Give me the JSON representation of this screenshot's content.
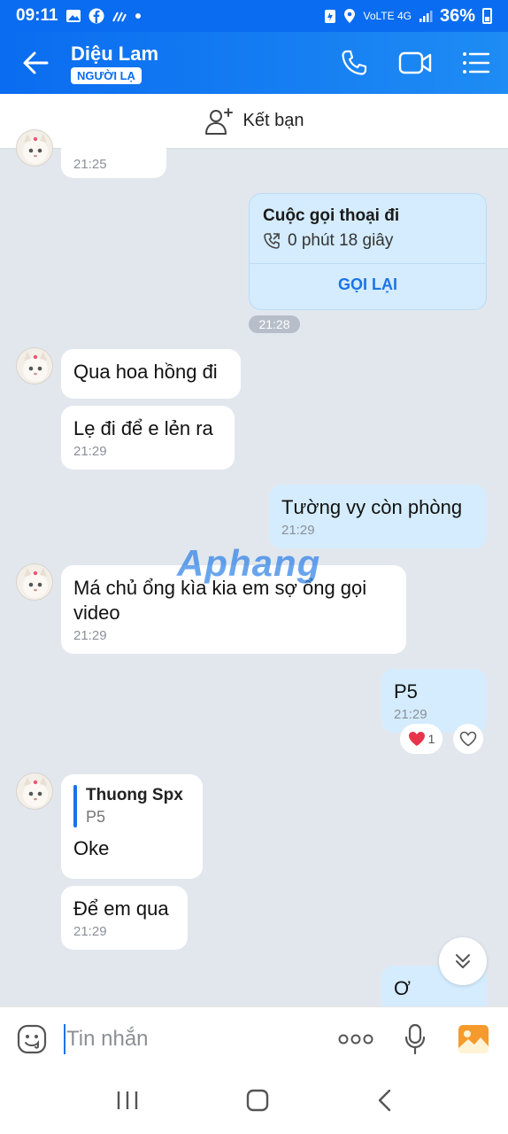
{
  "status_bar": {
    "time": "09:11",
    "network": "VoLTE 4G",
    "battery": "36%"
  },
  "header": {
    "contact_name": "Diệu Lam",
    "badge": "NGƯỜI LẠ",
    "icons": [
      "back-arrow-icon",
      "phone-icon",
      "video-call-icon",
      "menu-icon"
    ]
  },
  "add_friend": {
    "label": "Kết bạn",
    "icon": "add-person-icon"
  },
  "messages": [
    {
      "id": "m0",
      "side": "in",
      "text": "",
      "time": "21:25"
    },
    {
      "id": "call",
      "side": "out",
      "type": "call",
      "title": "Cuộc gọi thoại đi",
      "duration": "0 phút 18 giây",
      "action": "GỌI LẠI",
      "time": "21:28"
    },
    {
      "id": "m1",
      "side": "in",
      "text": "Qua hoa hồng đi",
      "time": ""
    },
    {
      "id": "m2",
      "side": "in",
      "text": "Lẹ đi để e lẻn ra",
      "time": "21:29"
    },
    {
      "id": "m3",
      "side": "out",
      "text": "Tường vy còn phòng",
      "time": "21:29"
    },
    {
      "id": "m4",
      "side": "in",
      "text": "Má chủ ổng kìa kia em sợ ổng gọi video",
      "time": "21:29"
    },
    {
      "id": "m5",
      "side": "out",
      "text": "P5",
      "time": "21:29",
      "reaction": {
        "emoji": "heart",
        "count": "1"
      }
    },
    {
      "id": "m6",
      "side": "in",
      "quote": {
        "name": "Thuong Spx",
        "text": "P5"
      },
      "text": "Oke",
      "time": ""
    },
    {
      "id": "m7",
      "side": "in",
      "text": "Để em qua",
      "time": "21:29"
    },
    {
      "id": "m8",
      "side": "out",
      "text": "Ơ",
      "time": ""
    }
  ],
  "watermark": "Aphang",
  "input_bar": {
    "placeholder": "Tin nhắn",
    "icons": [
      "emoji-icon",
      "more-icon",
      "microphone-icon",
      "image-icon"
    ]
  },
  "nav_bar": {
    "icons": [
      "recent-apps-icon",
      "home-icon",
      "back-icon"
    ]
  },
  "colors": {
    "header": "#0a6cf0",
    "outgoing_bubble": "#d4ecfd",
    "incoming_bubble": "#ffffff",
    "chat_bg": "#e2e7ee",
    "accent": "#1a73e8"
  }
}
